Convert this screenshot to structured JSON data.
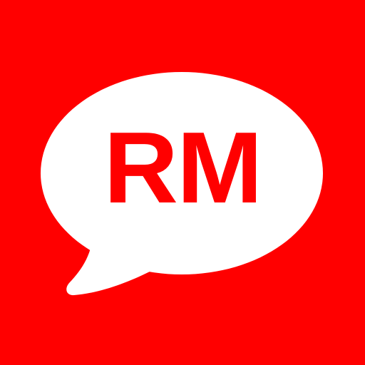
{
  "icon": {
    "monogram": "RM",
    "background_color": "#ff0000",
    "bubble_color": "#ffffff",
    "text_color": "#ff0000",
    "shape": "speech-bubble-icon"
  }
}
